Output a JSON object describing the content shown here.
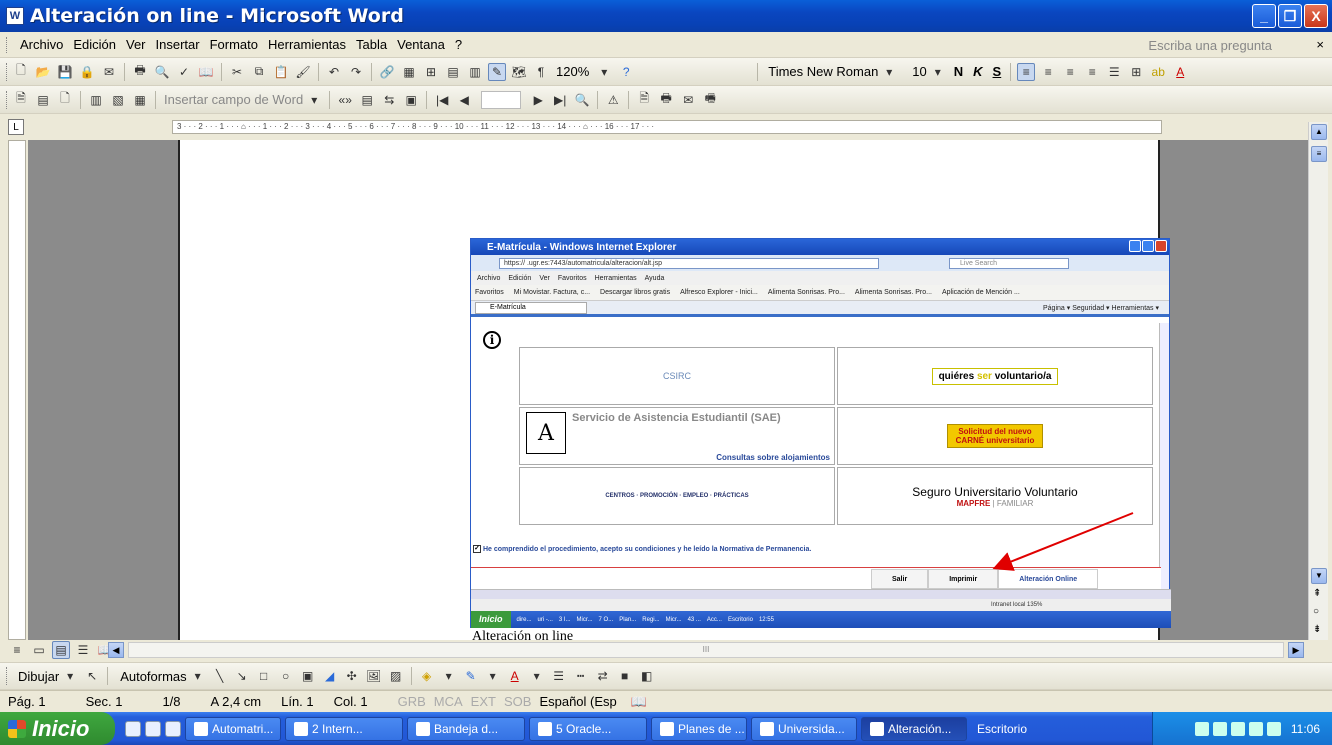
{
  "window": {
    "title": "Alteración on line - Microsoft Word",
    "minimize": "_",
    "maximize": "❐",
    "close": "X"
  },
  "menubar": {
    "items": [
      "Archivo",
      "Edición",
      "Ver",
      "Insertar",
      "Formato",
      "Herramientas",
      "Tabla",
      "Ventana",
      "?"
    ],
    "help_placeholder": "Escriba una pregunta",
    "close": "×"
  },
  "toolbar_standard": {
    "zoom": "120%",
    "pilcrow": "¶"
  },
  "toolbar_format": {
    "font": "Times New Roman",
    "size": "10",
    "bold": "N",
    "italic": "K",
    "underline": "S"
  },
  "toolbar_merge": {
    "insert_field": "Insertar campo de Word"
  },
  "ruler": {
    "marks": "3 · · · 2 · · · 1 · · · ⌂ · · · 1 · · · 2 · · · 3 · · · 4 · · · 5 · · · 6 · · · 7 · · · 8 · · · 9 · · · 10 · · · 11 · · · 12 · · · 13 · · · 14 · · · ⌂ · · · 16 · · · 17 · · ·",
    "corner": "L"
  },
  "embedded": {
    "ie_title": "E-Matrícula - Windows Internet Explorer",
    "address": "https://          .ugr.es:7443/automatricula/alteracion/alt.jsp",
    "search": "Live Search",
    "menu": [
      "Archivo",
      "Edición",
      "Ver",
      "Favoritos",
      "Herramientas",
      "Ayuda"
    ],
    "favorites": [
      "Favoritos",
      "Mi Movistar. Factura, c...",
      "Descargar libros gratis",
      "Alfresco Explorer - Inici...",
      "Alimenta Sonrisas. Pro...",
      "Alimenta Sonrisas. Pro...",
      "Aplicación de Mención ..."
    ],
    "tab": "E-Matrícula",
    "commands": "Página ▾  Seguridad ▾  Herramientas ▾",
    "info": "i",
    "csirc": "CSIRC",
    "voluntario_pre": "quiéres",
    "voluntario_ser": "ser",
    "voluntario_post": "voluntario/a",
    "sae_title": "Servicio de Asistencia Estudiantil (SAE)",
    "sae_link": "Consultas sobre alojamientos",
    "carne_line1": "Solicitud del nuevo",
    "carne_line2": "CARNÉ universitario",
    "cpep": "CENTROS · PROMOCIÓN · EMPLEO · PRÁCTICAS",
    "seguro_title": "Seguro Universitario Voluntario",
    "seguro_brand": "MAPFRE",
    "seguro_sub": "| FAMILIAR",
    "agree": "He comprendido el procedimiento, acepto su condiciones y he leído la Normativa de Permanencia.",
    "agree_check": "✓",
    "btn_salir": "Salir",
    "btn_imprimir": "Imprimir",
    "btn_alteracion": "Alteración Online",
    "status": "Intranet local            135%",
    "taskbar": [
      "Inicio",
      "dire...",
      "uri -...",
      "3 I...",
      "Micr...",
      "7 O...",
      "Plan...",
      "Regi...",
      "Micr...",
      "43 ...",
      "Acc...",
      "Escritorio",
      "12:55"
    ]
  },
  "caption": "Alteración on line",
  "hscroll": {
    "label": "III"
  },
  "drawing": {
    "dibujar": "Dibujar",
    "autoformas": "Autoformas"
  },
  "status": {
    "page": "Pág. 1",
    "section": "Sec. 1",
    "pages": "1/8",
    "at": "A 2,4 cm",
    "line": "Lín. 1",
    "col": "Col. 1",
    "grb": "GRB",
    "mca": "MCA",
    "ext": "EXT",
    "sob": "SOB",
    "lang": "Español (Esp"
  },
  "taskbar": {
    "start": "Inicio",
    "tasks": [
      "Automatri...",
      "2 Intern...",
      "Bandeja d...",
      "5 Oracle...",
      "Planes de ...",
      "Universida...",
      "Alteración..."
    ],
    "desktop": "Escritorio",
    "time": "11:06"
  }
}
